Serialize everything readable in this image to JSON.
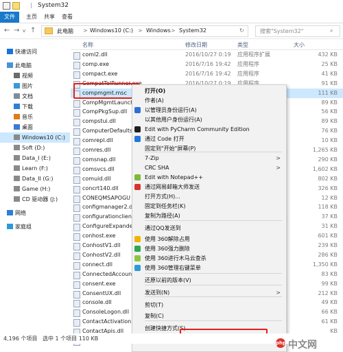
{
  "window": {
    "title": "System32"
  },
  "ribbon": {
    "tabs": [
      "文件",
      "主页",
      "共享",
      "查看"
    ]
  },
  "address": {
    "crumbs": [
      "此电脑",
      ">",
      "Windows10 (C:)",
      ">",
      "Windows",
      ">",
      "System32"
    ],
    "search_placeholder": "搜索\"System32\""
  },
  "nav": {
    "items": [
      {
        "label": "快速访问",
        "icon": "star-icon"
      },
      {
        "label": "此电脑",
        "icon": "pc-icon"
      },
      {
        "label": "视频",
        "icon": "video-icon"
      },
      {
        "label": "图片",
        "icon": "picture-icon"
      },
      {
        "label": "文档",
        "icon": "document-icon"
      },
      {
        "label": "下载",
        "icon": "download-icon"
      },
      {
        "label": "音乐",
        "icon": "music-icon"
      },
      {
        "label": "桌面",
        "icon": "desktop-icon"
      },
      {
        "label": "Windows10 (C:)",
        "icon": "drive-icon"
      },
      {
        "label": "Soft (D:)",
        "icon": "drive-icon"
      },
      {
        "label": "Data_I (E:)",
        "icon": "drive-icon"
      },
      {
        "label": "Learn (F:)",
        "icon": "drive-icon"
      },
      {
        "label": "Data_II (G:)",
        "icon": "drive-icon"
      },
      {
        "label": "Game (H:)",
        "icon": "drive-icon"
      },
      {
        "label": "CD 驱动器 (J:)",
        "icon": "cd-icon"
      },
      {
        "label": "网络",
        "icon": "network-icon"
      },
      {
        "label": "家庭组",
        "icon": "homegroup-icon"
      }
    ]
  },
  "columns": {
    "name": "名称",
    "date": "修改日期",
    "type": "类型",
    "size": "大小"
  },
  "files": [
    {
      "name": "coml2.dll",
      "date": "2016/10/27 0:19",
      "type": "应用程序扩展",
      "size": "432 KB"
    },
    {
      "name": "comp.exe",
      "date": "2016/7/16 19:42",
      "type": "应用程序",
      "size": "25 KB"
    },
    {
      "name": "compact.exe",
      "date": "2016/7/16 19:42",
      "type": "应用程序",
      "size": "41 KB"
    },
    {
      "name": "CompatTelRunner.exe",
      "date": "2016/10/27 0:19",
      "type": "应用程序",
      "size": "91 KB"
    },
    {
      "name": "compmgmt.msc",
      "date": "",
      "type": "控...",
      "size": "111 KB"
    },
    {
      "name": "CompMgmtLaunch",
      "date": "",
      "type": "",
      "size": "89 KB"
    },
    {
      "name": "CompPkgSup.dll",
      "date": "",
      "type": "",
      "size": "56 KB"
    },
    {
      "name": "compstui.dll",
      "date": "",
      "type": "",
      "size": "89 KB"
    },
    {
      "name": "ComputerDefaults.",
      "date": "",
      "type": "",
      "size": "76 KB"
    },
    {
      "name": "comrepl.dll",
      "date": "",
      "type": "",
      "size": "10 KB"
    },
    {
      "name": "comres.dll",
      "date": "",
      "type": "",
      "size": "1,265 KB"
    },
    {
      "name": "comsnap.dll",
      "date": "",
      "type": "",
      "size": "290 KB"
    },
    {
      "name": "comsvcs.dll",
      "date": "",
      "type": "",
      "size": "1,602 KB"
    },
    {
      "name": "comuid.dll",
      "date": "",
      "type": "",
      "size": "802 KB"
    },
    {
      "name": "concrt140.dll",
      "date": "",
      "type": "",
      "size": "326 KB"
    },
    {
      "name": "CONEQMSAPOGU",
      "date": "",
      "type": "",
      "size": "12 KB"
    },
    {
      "name": "configmanager2.dl",
      "date": "",
      "type": "",
      "size": "118 KB"
    },
    {
      "name": "configurationclient",
      "date": "",
      "type": "",
      "size": "37 KB"
    },
    {
      "name": "ConfigureExpande",
      "date": "",
      "type": "",
      "size": "31 KB"
    },
    {
      "name": "conhost.exe",
      "date": "",
      "type": "",
      "size": "601 KB"
    },
    {
      "name": "ConhostV1.dll",
      "date": "",
      "type": "",
      "size": "239 KB"
    },
    {
      "name": "ConhostV2.dll",
      "date": "",
      "type": "",
      "size": "286 KB"
    },
    {
      "name": "connect.dll",
      "date": "",
      "type": "",
      "size": "1,350 KB"
    },
    {
      "name": "ConnectedAccount",
      "date": "",
      "type": "",
      "size": "83 KB"
    },
    {
      "name": "consent.exe",
      "date": "",
      "type": "",
      "size": "99 KB"
    },
    {
      "name": "ConsentUX.dll",
      "date": "",
      "type": "",
      "size": "212 KB"
    },
    {
      "name": "console.dll",
      "date": "",
      "type": "",
      "size": "49 KB"
    },
    {
      "name": "ConsoleLogon.dll",
      "date": "",
      "type": "",
      "size": "66 KB"
    },
    {
      "name": "ContactActivation.",
      "date": "",
      "type": "",
      "size": "61 KB"
    },
    {
      "name": "ContactApis.dll",
      "date": "",
      "type": "",
      "size": "KB"
    },
    {
      "name": "ContactHarvesterD",
      "date": "",
      "type": "",
      "size": ""
    }
  ],
  "menu": {
    "items": [
      {
        "label": "打开(O)",
        "bold": true,
        "icon": "",
        "arrow": false
      },
      {
        "label": "作者(A)",
        "icon": "",
        "arrow": false
      },
      {
        "label": "以管理员身份运行(A)",
        "icon": "shield-icon",
        "arrow": false
      },
      {
        "label": "以其他用户身份运行(A)",
        "icon": "",
        "arrow": false
      },
      {
        "label": "Edit with PyCharm Community Edition",
        "icon": "pycharm-icon",
        "arrow": false
      },
      {
        "label": "通过 Code 打开",
        "icon": "vscode-icon",
        "arrow": false
      },
      {
        "label": "固定到\"开始\"屏幕(P)",
        "icon": "",
        "arrow": false
      },
      {
        "label": "7-Zip",
        "icon": "",
        "arrow": true
      },
      {
        "label": "CRC SHA",
        "icon": "",
        "arrow": true
      },
      {
        "label": "Edit with Notepad++",
        "icon": "notepadpp-icon",
        "arrow": false
      },
      {
        "label": "通过网易邮箱大师发送",
        "icon": "netease-mail-icon",
        "arrow": false
      },
      {
        "label": "打开方式(H)...",
        "icon": "",
        "arrow": false
      },
      {
        "label": "固定到任务栏(K)",
        "icon": "",
        "arrow": false
      },
      {
        "label": "复制为路径(A)",
        "icon": "",
        "arrow": false
      },
      {
        "label": "通过QQ发送到",
        "icon": "",
        "arrow": false
      },
      {
        "label": "使用 360解除占用",
        "icon": "360-unlock-icon",
        "arrow": false
      },
      {
        "label": "使用 360强力删除",
        "icon": "360-delete-icon",
        "arrow": false
      },
      {
        "label": "使用 360进行木马云查杀",
        "icon": "360-scan-icon",
        "arrow": false
      },
      {
        "label": "使用 360管理右键菜单",
        "icon": "360-menu-icon",
        "arrow": false
      },
      {
        "label": "还原以前的版本(V)",
        "icon": "",
        "arrow": false
      },
      {
        "label": "发送到(N)",
        "icon": "",
        "arrow": true
      },
      {
        "label": "剪切(T)",
        "icon": "",
        "arrow": false
      },
      {
        "label": "复制(C)",
        "icon": "",
        "arrow": false
      },
      {
        "label": "创建快捷方式(S)",
        "icon": "",
        "arrow": false
      },
      {
        "label": "删除(D)",
        "icon": "shield-icon",
        "arrow": false
      }
    ]
  },
  "status": {
    "count": "4,196 个项目",
    "selected": "选中 1 个项目 110 KB"
  },
  "watermark": {
    "text": "中文网",
    "logo": "php"
  }
}
